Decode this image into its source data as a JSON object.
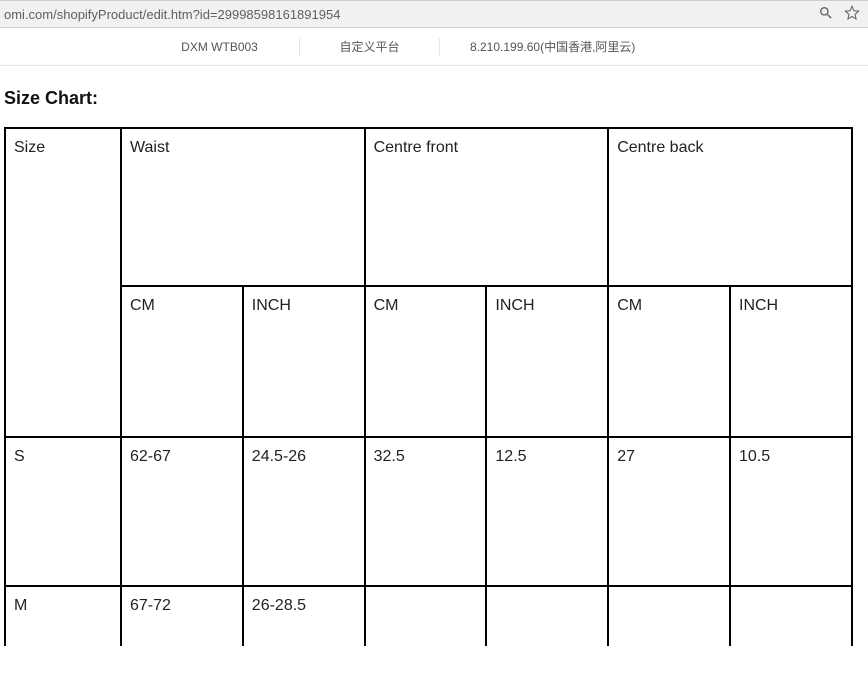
{
  "browser": {
    "url_fragment": "omi.com/shopifyProduct/edit.htm?id=29998598161891954"
  },
  "info_strip": {
    "sku": "DXM WTB003",
    "platform": "自定义平台",
    "server": "8.210.199.60(中国香港,阿里云)"
  },
  "section_title": "Size Chart:",
  "table": {
    "head1": {
      "size": "Size",
      "waist": "Waist",
      "centre_front": "Centre front",
      "centre_back": "Centre back"
    },
    "head2": {
      "cm": "CM",
      "inch": "INCH"
    },
    "rows": [
      {
        "size": "S",
        "waist_cm": "62-67",
        "waist_inch": "24.5-26",
        "cf_cm": "32.5",
        "cf_inch": "12.5",
        "cb_cm": "27",
        "cb_inch": "10.5"
      },
      {
        "size": "M",
        "waist_cm": "67-72",
        "waist_inch": "26-28.5",
        "cf_cm": "",
        "cf_inch": "",
        "cb_cm": "",
        "cb_inch": ""
      }
    ]
  },
  "chart_data": {
    "type": "table",
    "title": "Size Chart",
    "columns": [
      "Size",
      "Waist CM",
      "Waist INCH",
      "Centre front CM",
      "Centre front INCH",
      "Centre back CM",
      "Centre back INCH"
    ],
    "rows": [
      [
        "S",
        "62-67",
        "24.5-26",
        "32.5",
        "12.5",
        "27",
        "10.5"
      ],
      [
        "M",
        "67-72",
        "26-28.5",
        "",
        "",
        "",
        ""
      ]
    ]
  }
}
